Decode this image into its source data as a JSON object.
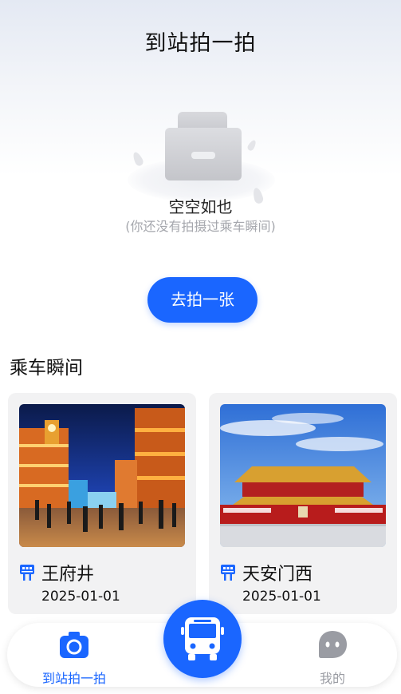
{
  "header": {
    "title": "到站拍一拍"
  },
  "empty_state": {
    "title": "空空如也",
    "subtitle": "(你还没有拍摄过乘车瞬间)",
    "icon": "empty-box-icon",
    "button_label": "去拍一张"
  },
  "section": {
    "title": "乘车瞬间",
    "cards": [
      {
        "station": "王府井",
        "date": "2025-01-01",
        "icon": "bus-stop-icon",
        "photo": "wangfujing-street-night"
      },
      {
        "station": "天安门西",
        "date": "2025-01-01",
        "icon": "bus-stop-icon",
        "photo": "tiananmen-gate"
      }
    ]
  },
  "bottom_nav": {
    "items": [
      {
        "label": "到站拍一拍",
        "icon": "camera-icon",
        "active": true
      },
      {
        "label": "我的",
        "icon": "profile-chat-icon",
        "active": false
      }
    ],
    "center_icon": "bus-icon"
  },
  "colors": {
    "accent": "#1a66ff",
    "inactive": "#9a9ca3",
    "card_bg": "#f2f2f3"
  }
}
